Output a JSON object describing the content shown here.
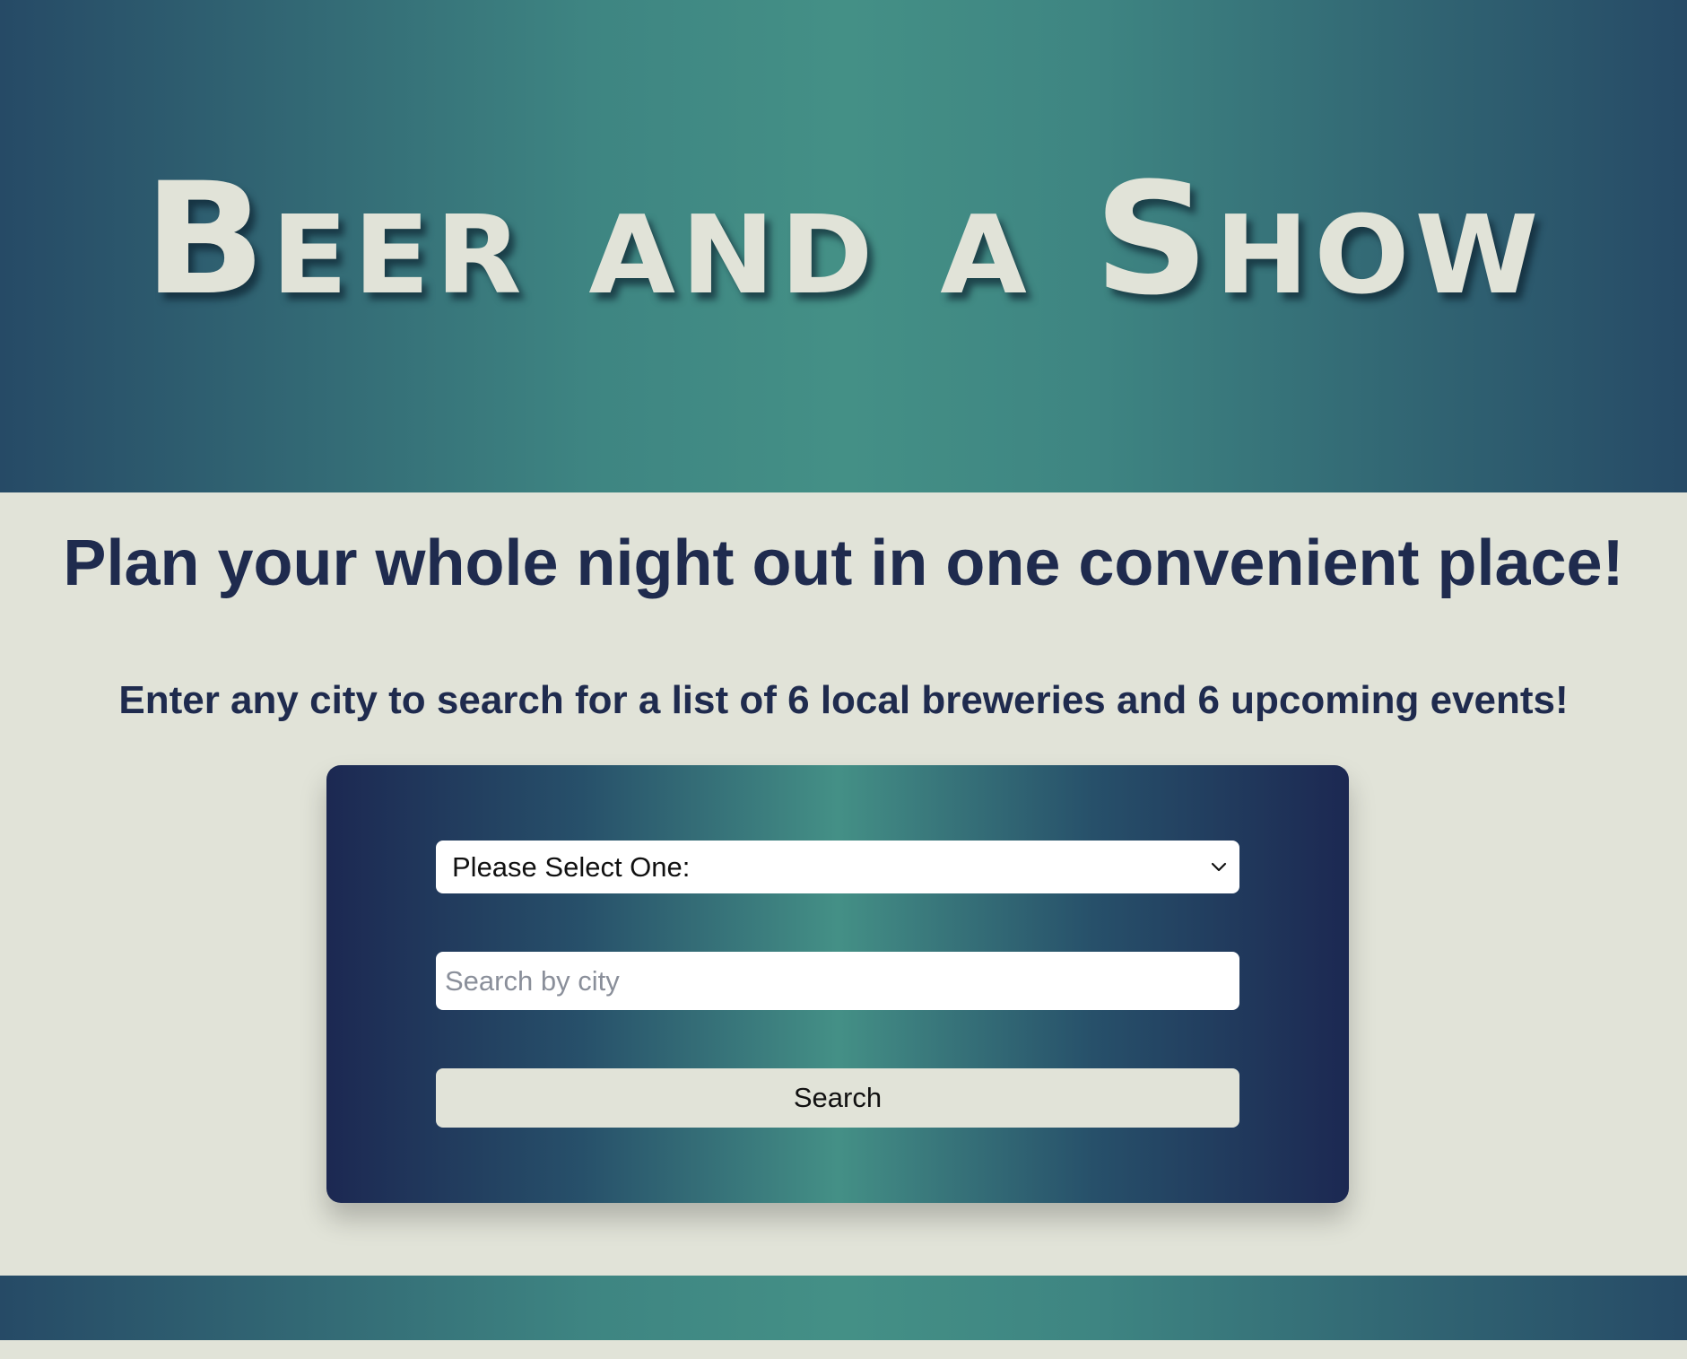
{
  "header": {
    "title": "Beer and a Show"
  },
  "main": {
    "headline": "Plan your whole night out in one convenient place!",
    "subheadline": "Enter any city to search for a list of 6 local breweries and 6 upcoming events!"
  },
  "search_form": {
    "select": {
      "selected_label": "Please Select One:",
      "icon": "chevron-down-icon"
    },
    "city_input": {
      "value": "",
      "placeholder": "Search by city"
    },
    "search_button_label": "Search"
  },
  "colors": {
    "background": "#e1e3d8",
    "heading_text": "#1f2b4e",
    "gradient_edge": "#264a66",
    "gradient_center": "#449086",
    "card_edge": "#1c2852"
  }
}
